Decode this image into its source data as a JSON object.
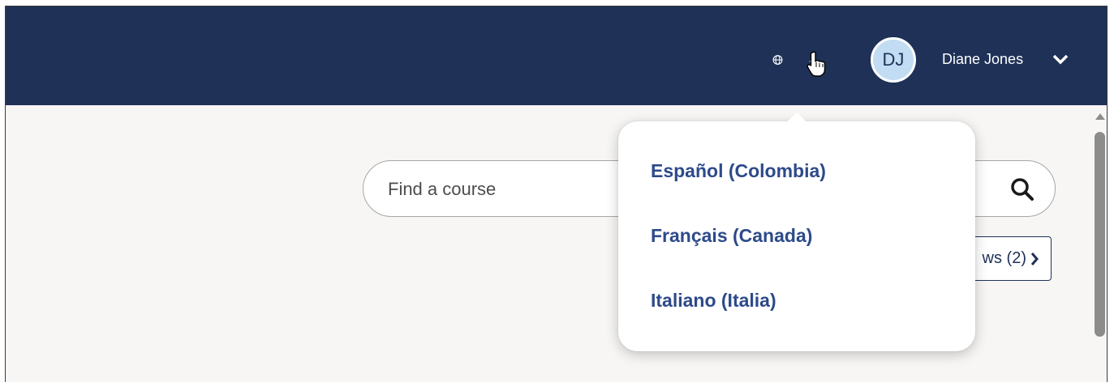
{
  "header": {
    "avatar_initials": "DJ",
    "user_name": "Diane Jones",
    "icons": {
      "language": "globe-icon",
      "user_menu": "chevron-down-icon",
      "cursor": "hand-pointer-cursor-icon"
    }
  },
  "search": {
    "placeholder": "Find a course",
    "value": "",
    "icon": "search-icon"
  },
  "views_button": {
    "label_visible": "ws (2)",
    "icon": "chevron-right-icon"
  },
  "language_menu": {
    "items": [
      {
        "label": "Español (Colombia)"
      },
      {
        "label": "Français (Canada)"
      },
      {
        "label": "Italiano (Italia)"
      }
    ]
  },
  "colors": {
    "header_bg": "#1f3157",
    "avatar_bg": "#c2dcf4",
    "menu_text": "#2d4a8a",
    "page_bg": "#f7f6f4"
  }
}
